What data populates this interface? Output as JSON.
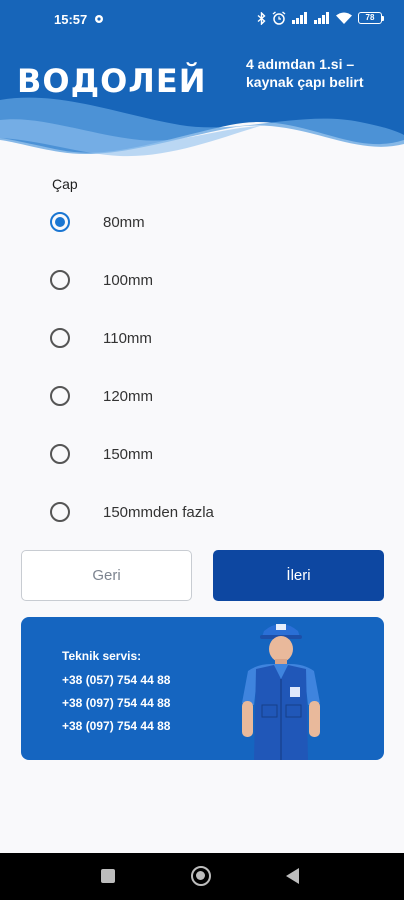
{
  "status_bar": {
    "time": "15:57",
    "battery": "78",
    "icons": [
      "gear-icon",
      "bluetooth-icon",
      "alarm-icon",
      "signal-icon",
      "signal-icon",
      "wifi-icon",
      "battery-icon"
    ]
  },
  "header": {
    "logo": "ВОДОЛЕЙ",
    "step_text": "4 adımdan 1.si – kaynak çapı belirt",
    "colors": {
      "primary": "#1765b9",
      "wave_light": "#5fa1e0"
    }
  },
  "form": {
    "label": "Çap",
    "selected": "80mm",
    "options": [
      {
        "label": "80mm",
        "checked": true
      },
      {
        "label": "100mm",
        "checked": false
      },
      {
        "label": "110mm",
        "checked": false
      },
      {
        "label": "120mm",
        "checked": false
      },
      {
        "label": "150mm",
        "checked": false
      },
      {
        "label": "150mmden fazla",
        "checked": false
      }
    ]
  },
  "buttons": {
    "back": "Geri",
    "next": "İleri",
    "next_color": "#0d47a1"
  },
  "service": {
    "title": "Teknik servis:",
    "phones": [
      "+38 (057) 754 44 88",
      "+38 (097) 754 44 88",
      "+38 (097) 754 44 88"
    ],
    "card_color": "#1565c0"
  },
  "nav": {
    "icons": [
      "recent-apps-icon",
      "home-icon",
      "back-icon"
    ]
  }
}
